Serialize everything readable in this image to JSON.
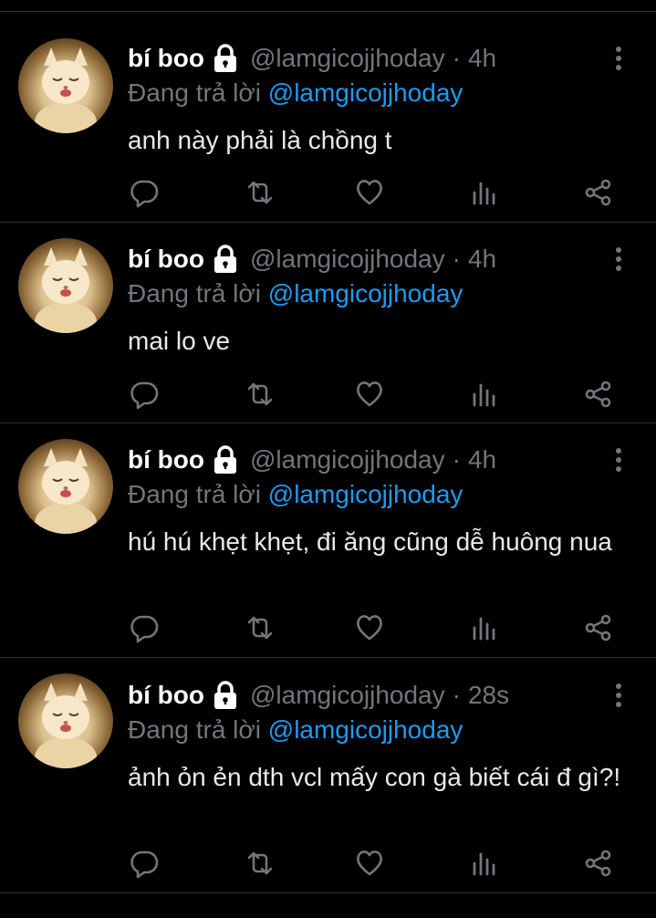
{
  "tweets": [
    {
      "display_name": "bí boo",
      "handle": "@lamgicojjhoday",
      "separator": "·",
      "time": "4h",
      "reply_prefix": "Đang trả lời",
      "reply_handle": "@lamgicojjhoday",
      "text": "anh này phải là chồng t"
    },
    {
      "display_name": "bí boo",
      "handle": "@lamgicojjhoday",
      "separator": "·",
      "time": "4h",
      "reply_prefix": "Đang trả lời",
      "reply_handle": "@lamgicojjhoday",
      "text": "mai lo ve"
    },
    {
      "display_name": "bí boo",
      "handle": "@lamgicojjhoday",
      "separator": "·",
      "time": "4h",
      "reply_prefix": "Đang trả lời",
      "reply_handle": "@lamgicojjhoday",
      "text": "hú hú khẹt khẹt, đi ăng cũng dễ huông nua"
    },
    {
      "display_name": "bí boo",
      "handle": "@lamgicojjhoday",
      "separator": "·",
      "time": "28s",
      "reply_prefix": "Đang trả lời",
      "reply_handle": "@lamgicojjhoday",
      "text": "ảnh ỏn ẻn dth vcl mấy con gà biết cái đ gì?!"
    }
  ],
  "icons": {
    "lock": "lock-icon",
    "more": "more-vertical-icon",
    "reply": "reply-icon",
    "retweet": "retweet-icon",
    "like": "heart-icon",
    "views": "analytics-icon",
    "share": "share-icon"
  },
  "colors": {
    "background": "#000000",
    "text": "#e7e9ea",
    "secondary": "#71767b",
    "link": "#1d9bf0",
    "divider": "#2f3336"
  }
}
